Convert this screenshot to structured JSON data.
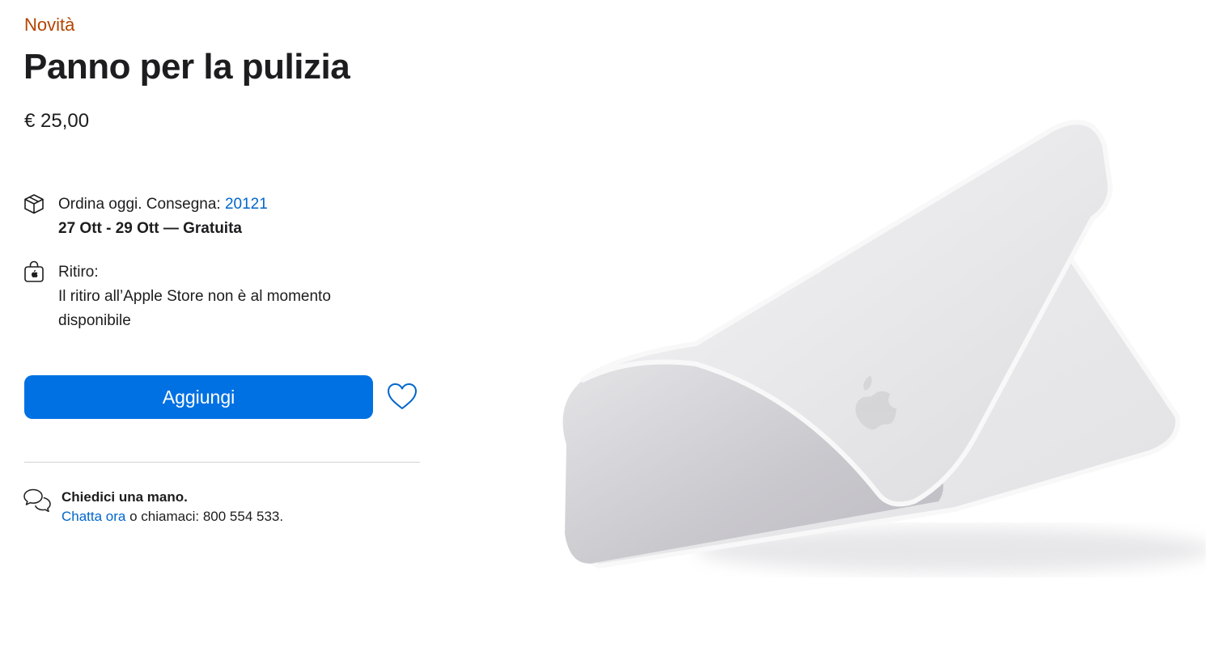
{
  "product": {
    "badge": "Novità",
    "title": "Panno per la pulizia",
    "price": "€ 25,00"
  },
  "delivery": {
    "icon": "box-icon",
    "prefix": "Ordina oggi. Consegna: ",
    "zip_link": "20121",
    "dates": "27 Ott - 29 Ott — Gratuita"
  },
  "pickup": {
    "icon": "store-bag-icon",
    "label": "Ritiro:",
    "message": "Il ritiro all’Apple Store non è al momento disponibile"
  },
  "actions": {
    "add_label": "Aggiungi",
    "favorite_icon": "heart-icon",
    "button_color": "#0071e3"
  },
  "help": {
    "icon": "chat-bubbles-icon",
    "title": "Chiedici una mano.",
    "chat_link": "Chatta ora",
    "call_text": " o chiamaci: 800 554 533."
  },
  "colors": {
    "badge": "#b64400",
    "link": "#0066cc",
    "text": "#1d1d1f"
  }
}
